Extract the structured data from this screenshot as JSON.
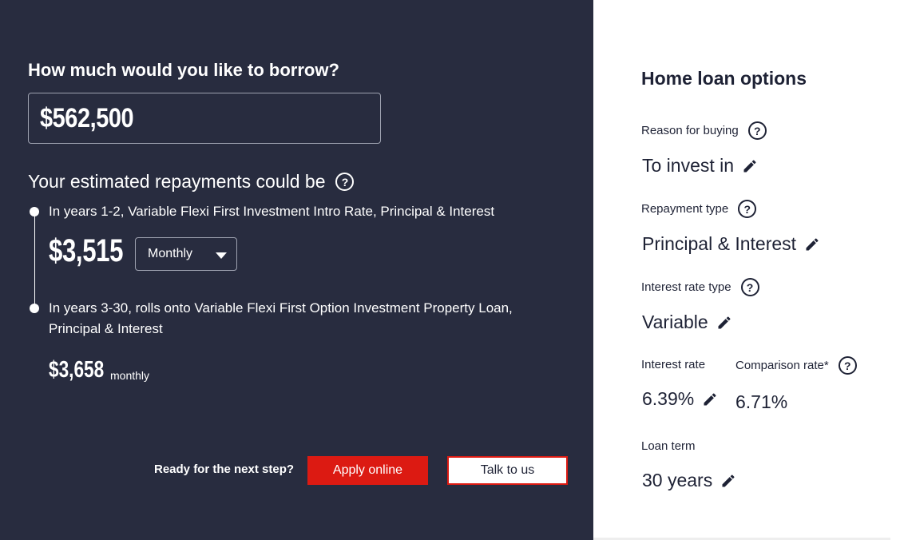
{
  "calculator": {
    "borrow_heading": "How much would you like to borrow?",
    "borrow_amount": "$562,500",
    "repayments_heading": "Your estimated repayments could be",
    "phase1_text": "In years 1-2, Variable Flexi First Investment Intro Rate, Principal & Interest",
    "phase1_amount": "$3,515",
    "frequency_selected": "Monthly",
    "phase2_text": "In years 3-30, rolls onto Variable Flexi First Option Investment Property Loan, Principal & Interest",
    "phase2_amount": "$3,658",
    "phase2_unit": "monthly",
    "next_step_label": "Ready for the next step?",
    "apply_label": "Apply online",
    "talk_label": "Talk to us",
    "help_glyph": "?"
  },
  "options": {
    "title": "Home loan options",
    "reason_label": "Reason for buying",
    "reason_value": "To invest in",
    "repayment_type_label": "Repayment type",
    "repayment_type_value": "Principal & Interest",
    "interest_rate_type_label": "Interest rate type",
    "interest_rate_type_value": "Variable",
    "interest_rate_label": "Interest rate",
    "interest_rate_value": "6.39%",
    "comparison_rate_label": "Comparison rate*",
    "comparison_rate_value": "6.71%",
    "loan_term_label": "Loan term",
    "loan_term_value": "30 years"
  },
  "colors": {
    "left_panel": "#282c3f",
    "accent_red": "#dc1a12",
    "text_dark": "#1e2235"
  },
  "icons": {
    "help": "question-circle-icon",
    "edit": "pencil-icon",
    "dropdown": "caret-down-icon"
  }
}
